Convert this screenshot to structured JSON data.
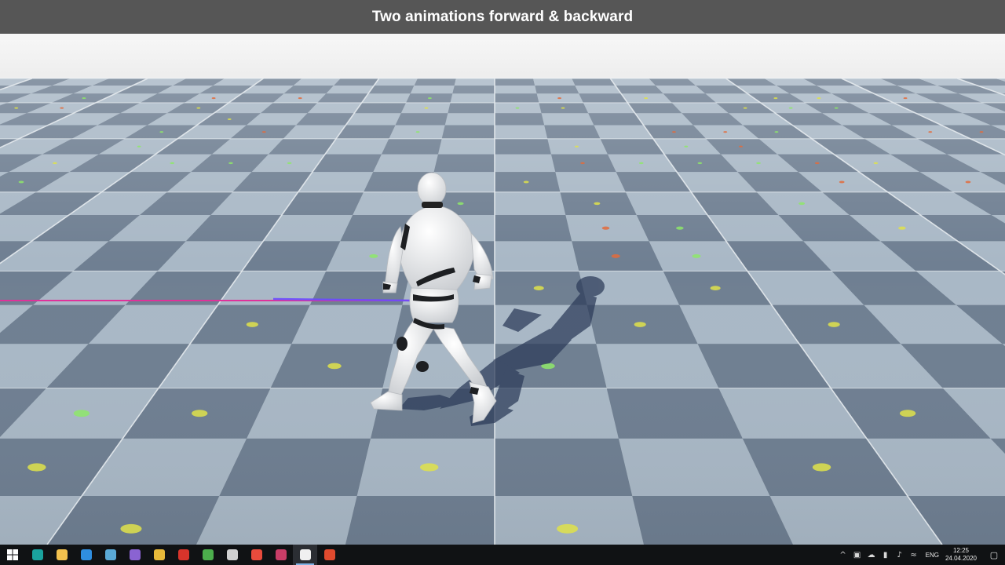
{
  "window": {
    "title": "Two animations forward & backward"
  },
  "viewport": {
    "scene": "3d-viewport",
    "sky_color": "#f2f2f2",
    "tile_dark_color": "#6f7f92",
    "tile_light_color": "#a9b8c6",
    "grid_line_color": "#e6ebef",
    "trail_colors": [
      "#e0319a",
      "#6a4cff"
    ],
    "mannequin_color": "#e9e9e9"
  },
  "taskbar": {
    "start_icon": "windows-logo-icon",
    "apps": [
      {
        "name": "edge-icon",
        "color": "#1aa39e",
        "active": false
      },
      {
        "name": "file-explorer-icon",
        "color": "#f2c14e",
        "active": false
      },
      {
        "name": "app-blue-icon",
        "color": "#2f8ee0",
        "active": false
      },
      {
        "name": "app-window-icon",
        "color": "#5aa9d6",
        "active": false
      },
      {
        "name": "visual-studio-icon",
        "color": "#8a63d2",
        "active": false
      },
      {
        "name": "chrome-icon",
        "color": "#e7b93a",
        "active": false
      },
      {
        "name": "app-red-icon",
        "color": "#d8342b",
        "active": false
      },
      {
        "name": "app-green-icon",
        "color": "#4cae4c",
        "active": false
      },
      {
        "name": "obs-icon",
        "color": "#d0d0d0",
        "active": false
      },
      {
        "name": "app-colorful-icon",
        "color": "#e94b3c",
        "active": false
      },
      {
        "name": "app-mail-icon",
        "color": "#c93d67",
        "active": false
      },
      {
        "name": "unreal-engine-icon",
        "color": "#f0f0f0",
        "active": true
      },
      {
        "name": "app-shield-icon",
        "color": "#e04a2e",
        "active": false
      }
    ],
    "tray": {
      "language": "ENG",
      "time": "12:25",
      "date": "24.04.2020"
    }
  }
}
